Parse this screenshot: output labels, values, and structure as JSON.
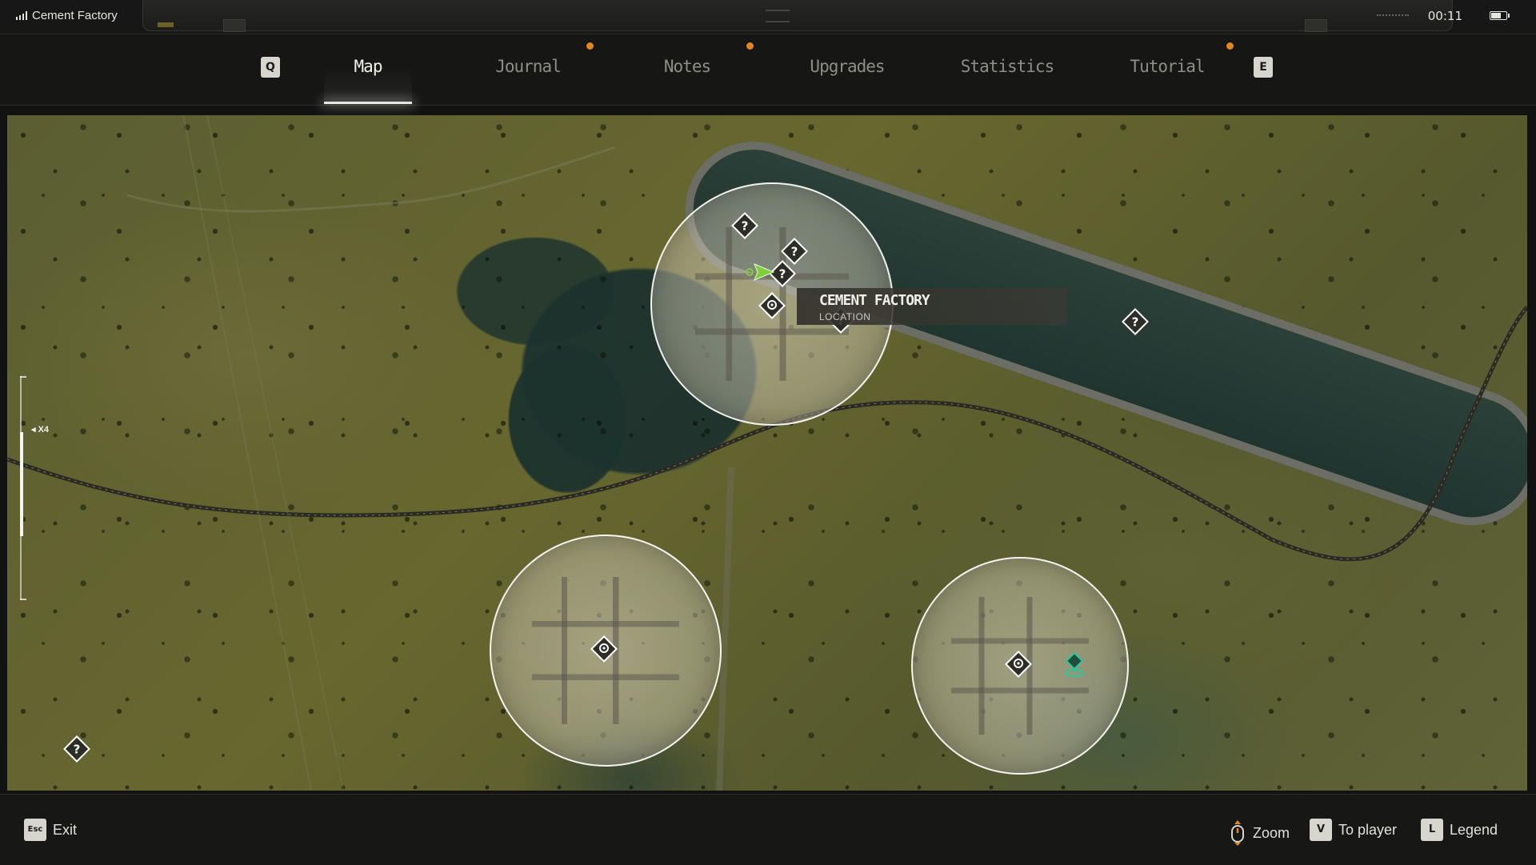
{
  "status": {
    "location_name": "Cement Factory",
    "time": "00:11",
    "battery_level": 0.75
  },
  "tabs": [
    {
      "label": "Map",
      "active": true,
      "notification": false
    },
    {
      "label": "Journal",
      "active": false,
      "notification": true
    },
    {
      "label": "Notes",
      "active": false,
      "notification": true
    },
    {
      "label": "Upgrades",
      "active": false,
      "notification": false
    },
    {
      "label": "Statistics",
      "active": false,
      "notification": false
    },
    {
      "label": "Tutorial",
      "active": false,
      "notification": true
    }
  ],
  "tab_keys": {
    "prev": "Q",
    "next": "E"
  },
  "map": {
    "tooltip": {
      "title": "CEMENT FACTORY",
      "subtitle": "LOCATION"
    },
    "zoom": {
      "label": "◂ X4"
    },
    "marker_symbol": "?"
  },
  "colors": {
    "accent_notification": "#e0871f",
    "player_arrow": "#7fce3a",
    "quest_marker": "#2fc59a"
  },
  "icons": [
    "signal-icon",
    "battery-icon",
    "player-arrow-icon",
    "unknown-marker-icon",
    "location-marker-icon",
    "quest-marker-icon",
    "scroll-wheel-icon"
  ],
  "bottom": {
    "exit": {
      "key": "Esc",
      "label": "Exit"
    },
    "zoom": {
      "label": "Zoom"
    },
    "to_player": {
      "key": "V",
      "label": "To player"
    },
    "legend": {
      "key": "L",
      "label": "Legend"
    }
  }
}
